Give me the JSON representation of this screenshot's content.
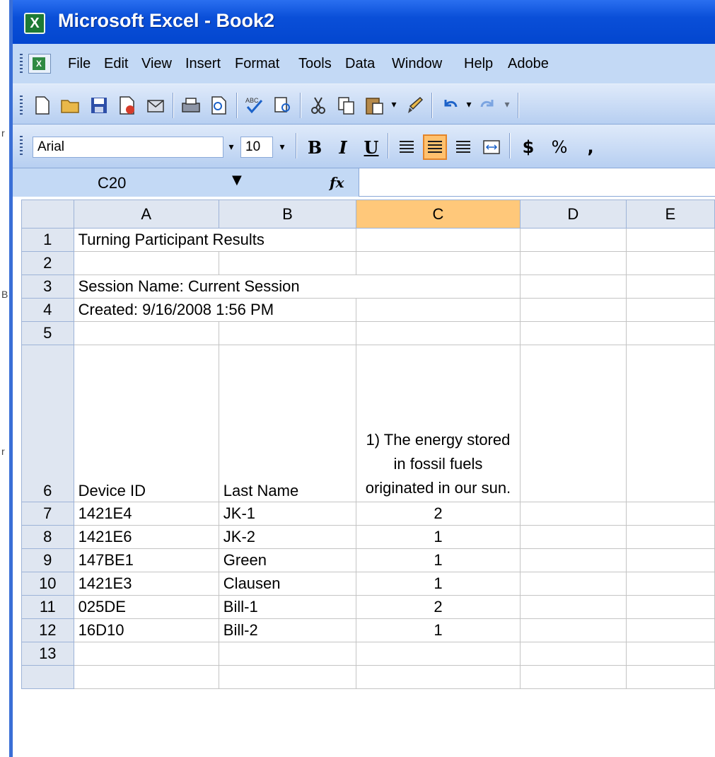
{
  "window": {
    "title": "Microsoft Excel - Book2",
    "app_icon": "X"
  },
  "menu": [
    "File",
    "Edit",
    "View",
    "Insert",
    "Format",
    "Tools",
    "Data",
    "Window",
    "Help",
    "Adobe"
  ],
  "formatting": {
    "font": "Arial",
    "size": "10",
    "bold": "B",
    "italic": "I",
    "underline": "U",
    "currency": "$",
    "percent": "%",
    "comma": ","
  },
  "formula_bar": {
    "name_box": "C20",
    "fx": "fx",
    "formula": ""
  },
  "columns": [
    "A",
    "B",
    "C",
    "D",
    "E"
  ],
  "rows": [
    {
      "n": "1",
      "a": "Turning Participant Results",
      "b": "",
      "c": ""
    },
    {
      "n": "2",
      "a": "",
      "b": "",
      "c": ""
    },
    {
      "n": "3",
      "a": "Session Name: Current Session",
      "b": "",
      "c": ""
    },
    {
      "n": "4",
      "a": "Created: 9/16/2008 1:56 PM",
      "b": "",
      "c": ""
    },
    {
      "n": "5",
      "a": "",
      "b": "",
      "c": ""
    },
    {
      "n": "6",
      "a": "Device ID",
      "b": "Last Name",
      "c": "1) The energy stored in fossil fuels originated in our sun."
    },
    {
      "n": "7",
      "a": "1421E4",
      "b": "JK-1",
      "c": "2"
    },
    {
      "n": "8",
      "a": "1421E6",
      "b": "JK-2",
      "c": "1"
    },
    {
      "n": "9",
      "a": "147BE1",
      "b": "Green",
      "c": "1"
    },
    {
      "n": "10",
      "a": "1421E3",
      "b": "Clausen",
      "c": "1"
    },
    {
      "n": "11",
      "a": "025DE",
      "b": "Bill-1",
      "c": "2"
    },
    {
      "n": "12",
      "a": "16D10",
      "b": "Bill-2",
      "c": "1"
    },
    {
      "n": "13",
      "a": "",
      "b": "",
      "c": ""
    }
  ],
  "side_marks": [
    "r",
    "B",
    "r"
  ]
}
